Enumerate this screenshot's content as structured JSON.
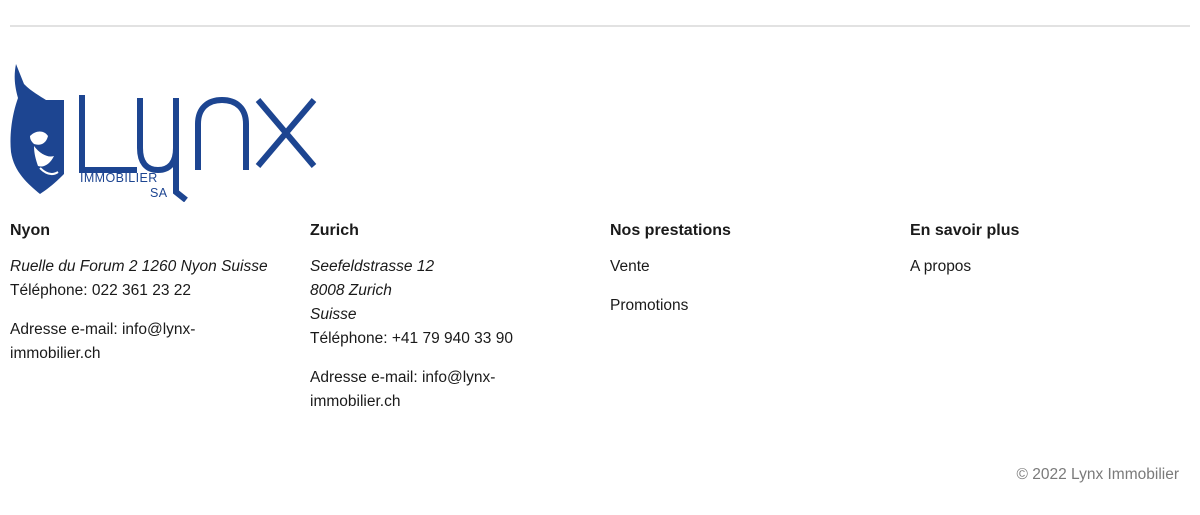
{
  "logo": {
    "brand": "Lynx",
    "line1": "IMMOBILIER",
    "line2": "SA",
    "color": "#1d4591"
  },
  "columns": {
    "nyon": {
      "title": "Nyon",
      "address": "Ruelle du Forum 2 1260 Nyon Suisse",
      "phone": "Téléphone: 022 361 23 22",
      "email_prefix": "Adresse e-mail: ",
      "email": "info@lynx-immobilier.ch"
    },
    "zurich": {
      "title": "Zurich",
      "address_lines": [
        "Seefeldstrasse 12",
        "8008 Zurich",
        "Suisse"
      ],
      "phone": "Téléphone: +41 79 940 33 90",
      "email_prefix": "Adresse e-mail: ",
      "email": "info@lynx-immobilier.ch"
    },
    "services": {
      "title": "Nos prestations",
      "links": [
        "Vente",
        "Promotions"
      ]
    },
    "more": {
      "title": "En savoir plus",
      "links": [
        "A propos"
      ]
    }
  },
  "footer": {
    "copyright": "© 2022 Lynx Immobilier"
  }
}
